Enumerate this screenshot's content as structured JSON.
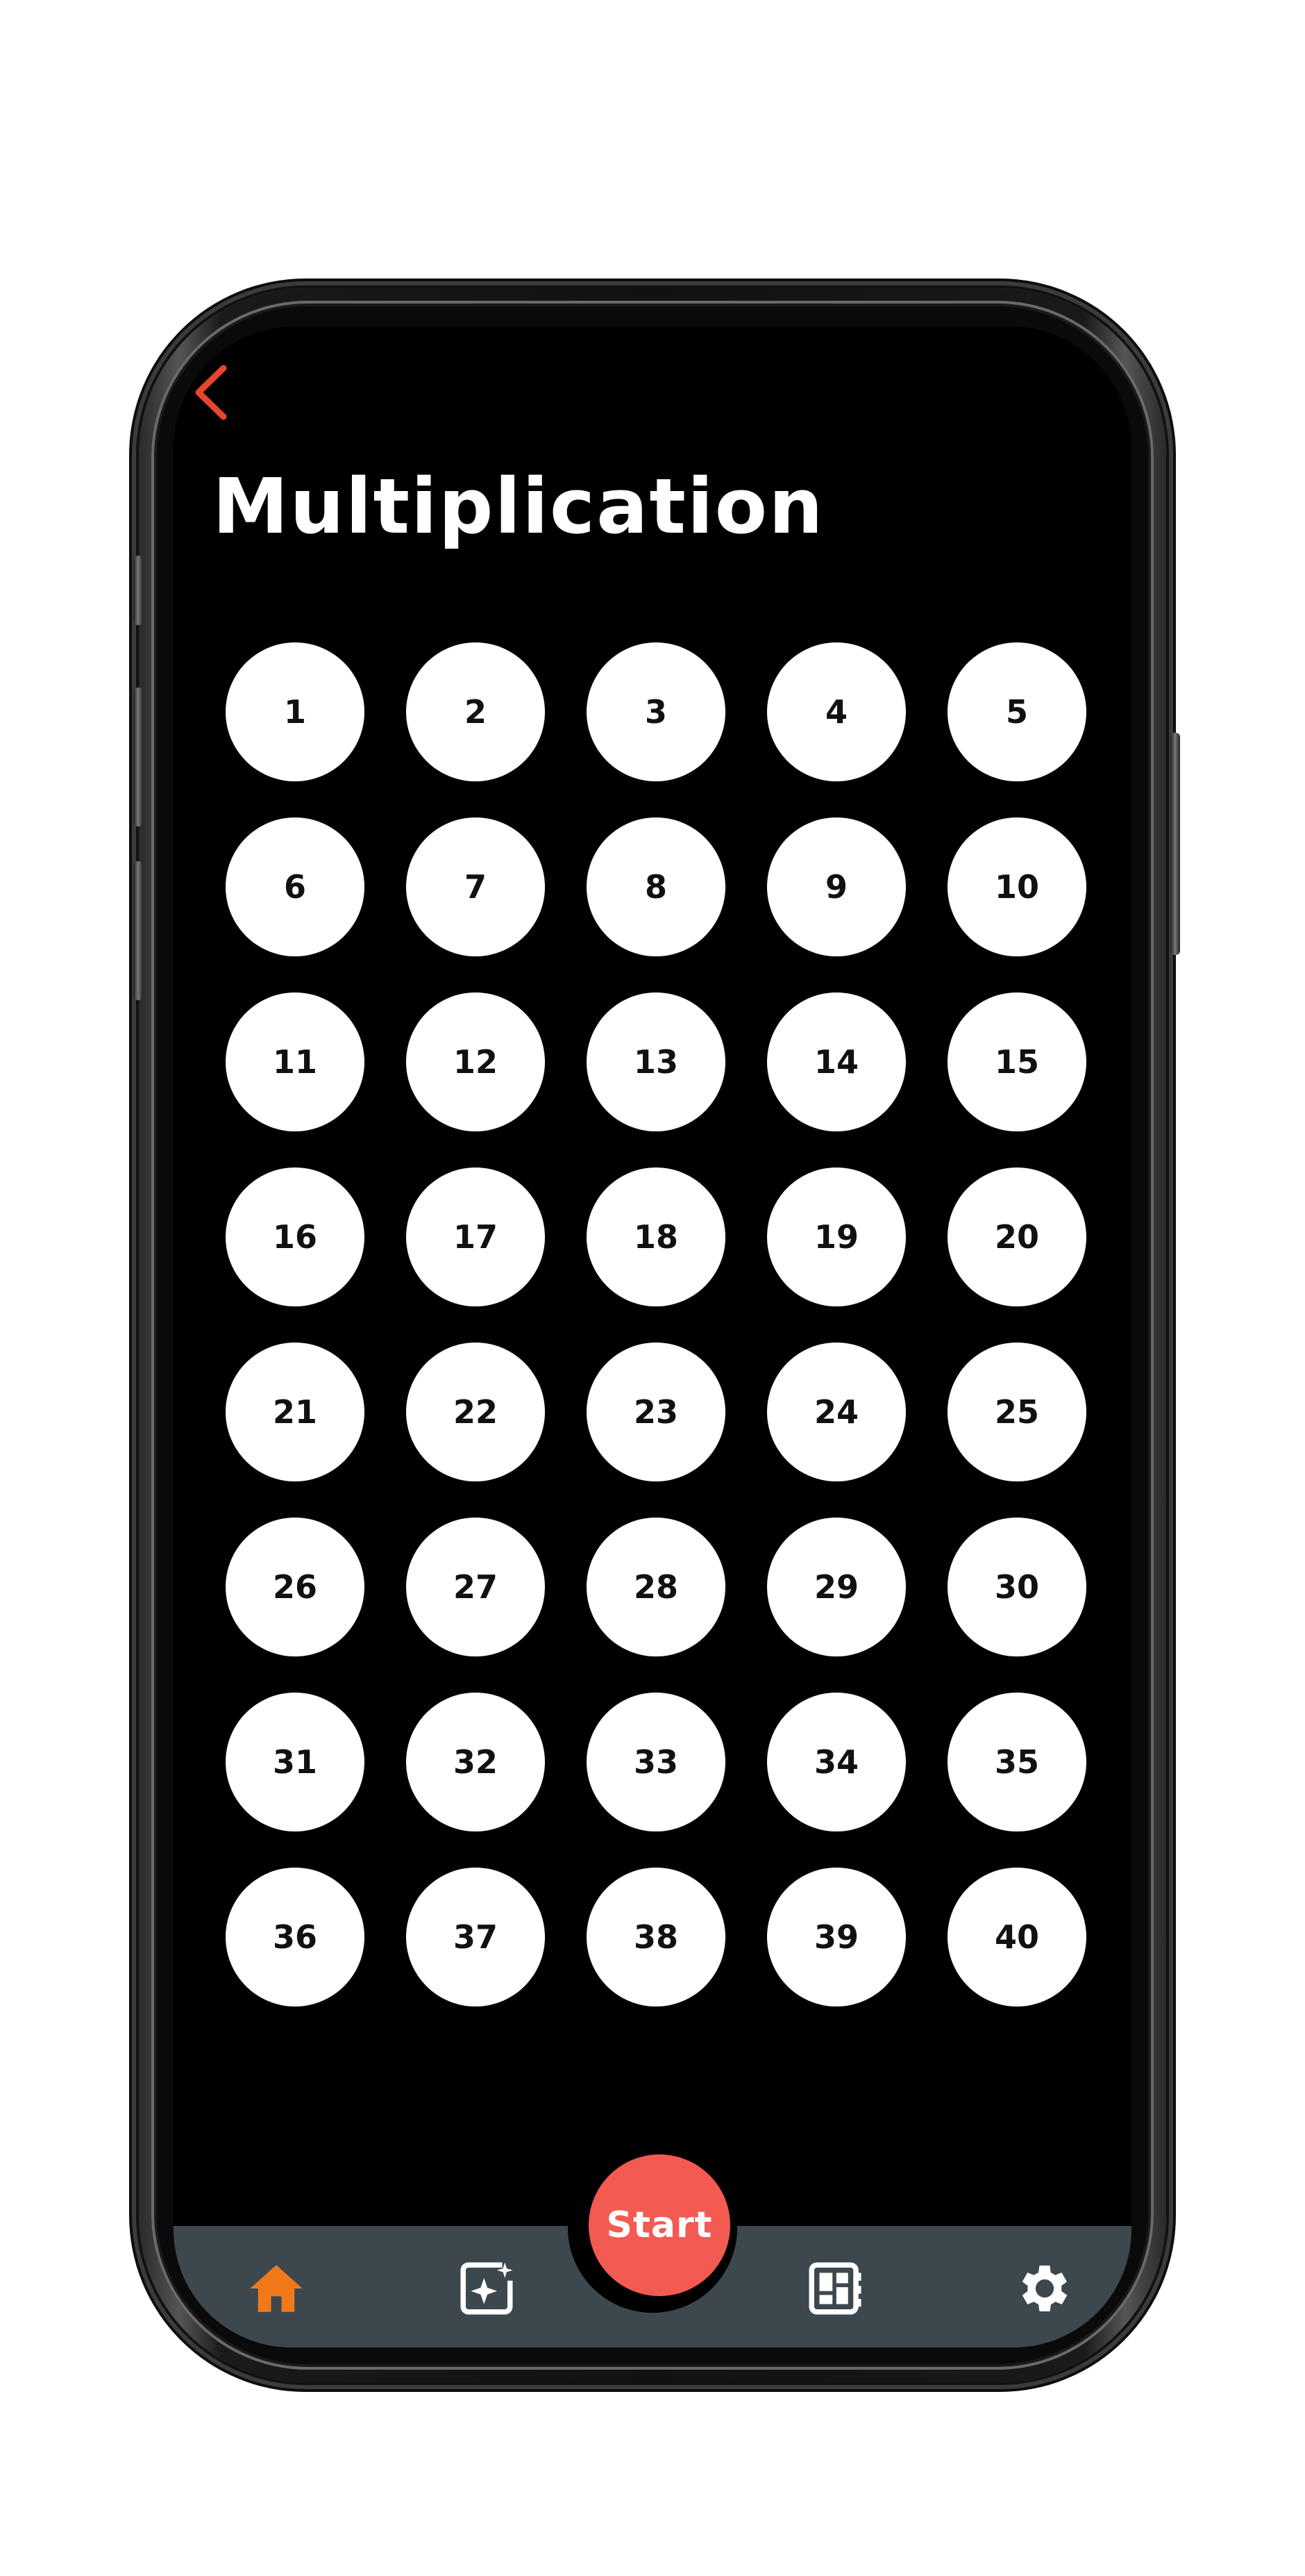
{
  "page": {
    "title": "Multiplication"
  },
  "grid": {
    "items": [
      "1",
      "2",
      "3",
      "4",
      "5",
      "6",
      "7",
      "8",
      "9",
      "10",
      "11",
      "12",
      "13",
      "14",
      "15",
      "16",
      "17",
      "18",
      "19",
      "20",
      "21",
      "22",
      "23",
      "24",
      "25",
      "26",
      "27",
      "28",
      "29",
      "30",
      "31",
      "32",
      "33",
      "34",
      "35",
      "36",
      "37",
      "38",
      "39",
      "40"
    ]
  },
  "bottom_nav": {
    "start_label": "Start",
    "tabs": [
      {
        "icon": "home-icon",
        "active": true
      },
      {
        "icon": "sparkle-edit-icon",
        "active": false
      },
      {
        "icon": "dashboard-icon",
        "active": false
      },
      {
        "icon": "gear-icon",
        "active": false
      }
    ]
  },
  "colors": {
    "accent": "#f25a52",
    "active_tab": "#f07a1a",
    "tabbar_bg": "#3d484e",
    "screen_bg": "#000000",
    "cell_bg": "#ffffff"
  },
  "icons": {
    "back": "chevron-left-icon"
  }
}
